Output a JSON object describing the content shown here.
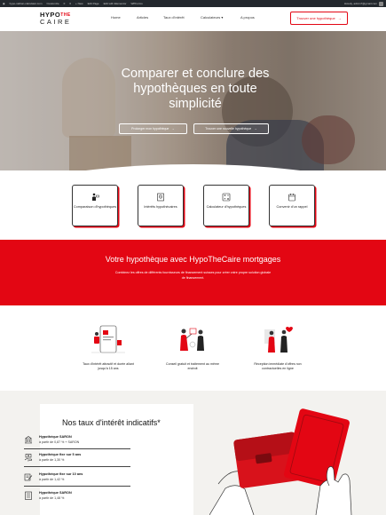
{
  "admin_bar": {
    "site": "hypo-nathan-calculator.com",
    "items": [
      "Customize",
      "0",
      "0",
      "+ New",
      "Edit Page",
      "Edit with Elementor",
      "WPForms"
    ],
    "greeting": "Howdy, admin7@gmail.com"
  },
  "header": {
    "logo": {
      "line1a": "HYPO",
      "line1b": "THE",
      "line2": "CAIRE"
    },
    "nav": [
      "Home",
      "Articles",
      "Taux d'intérêt",
      "Calculateurs",
      "A propos"
    ],
    "nav_dropdown_index": 3,
    "cta": "Trouver une hypothèque"
  },
  "hero": {
    "title": "Comparer et conclure des hypothèques en toute simplicité",
    "buttons": [
      "Prolonger mon hypothèque",
      "Trouver une nouvelle hypothèque"
    ]
  },
  "services": [
    {
      "icon": "comparison-icon",
      "label": "Comparaison d'hypothèques"
    },
    {
      "icon": "interest-icon",
      "label": "Intérêts hypothécaires"
    },
    {
      "icon": "calculator-icon",
      "label": "Calculateur d'hypothèques"
    },
    {
      "icon": "calendar-icon",
      "label": "Convenir d'un rappel"
    }
  ],
  "red_band": {
    "title": "Votre hypothèque avec HypoTheCaire mortgages",
    "text": "Combinez les offres de différents fournisseurs de financement suisses pour créer votre propre solution globale de financement."
  },
  "features": [
    {
      "icon": "rate-illustration",
      "text": "Taux d'intérêt attractif et durée allant jusqu'à 15 ans"
    },
    {
      "icon": "advice-illustration",
      "text": "Conseil gratuit et traitement au même endroit"
    },
    {
      "icon": "offers-illustration",
      "text": "Réception immédiate d'offres non contractuelles en ligne"
    }
  ],
  "rates": {
    "title": "Nos taux d'intérêt indicatifs*",
    "items": [
      {
        "name": "Hypothèque SARON",
        "value": "à partir de 0,87 % + SARON"
      },
      {
        "name": "Hypothèque fixe sur 5 ans",
        "value": "à partir de 1,30 %"
      },
      {
        "name": "Hypothèque fixe sur 10 ans",
        "value": "à partir de 1,42 %"
      },
      {
        "name": "Hypothèque SARON",
        "value": "à partir de 1,48 %"
      }
    ]
  },
  "colors": {
    "accent": "#e30613",
    "dark": "#1a1a1a",
    "section_bg": "#f3f2ef"
  }
}
